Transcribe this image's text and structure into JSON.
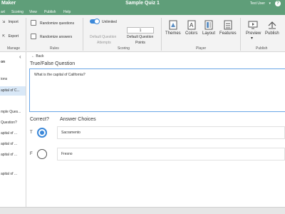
{
  "titlebar": {
    "app_name": "Maker",
    "document_title": "Sample Quiz 1",
    "user": "Test User",
    "caret": "▾",
    "help": "?"
  },
  "menu": [
    "art",
    "Scoring",
    "View",
    "Publish",
    "Help"
  ],
  "ribbon": {
    "manage": {
      "import": "Import",
      "export": "Export",
      "label": "Manage"
    },
    "rules": {
      "randomize_questions": "Randomize questions",
      "randomize_answers": "Randomize answers",
      "label": "Rules"
    },
    "scoring": {
      "unlimited": "Unlimited",
      "default_attempts": "Default Question",
      "attempts_word": "Attempts",
      "points_value": "1",
      "default_points_line1": "Default Question",
      "default_points_line2": "Points",
      "label": "Scoring"
    },
    "player": {
      "themes": "Themes",
      "colors": "Colors",
      "layout": "Layout",
      "features": "Features",
      "label": "Player"
    },
    "publish": {
      "preview": "Preview",
      "preview_caret": "▾",
      "publish": "Publish",
      "label": "Publish"
    }
  },
  "sidebar": {
    "collapse": "‹",
    "items": [
      "on",
      "ions",
      "apital of C...",
      "mple Ques...",
      "Question?",
      "apital of ...",
      "apital of ...",
      "apital of ...",
      "apital of ..."
    ]
  },
  "main": {
    "back": "← Back",
    "question_type": "True/False Question",
    "question_text": "What is the capital of California?",
    "correct_header": "Correct?",
    "answers_header": "Answer Choices",
    "choices": [
      {
        "tf": "T",
        "text": "Sacramento",
        "selected": true
      },
      {
        "tf": "F",
        "text": "Fresno",
        "selected": false
      }
    ]
  },
  "colors": {
    "accent": "#5f9e79",
    "selection": "#3b88d9"
  }
}
